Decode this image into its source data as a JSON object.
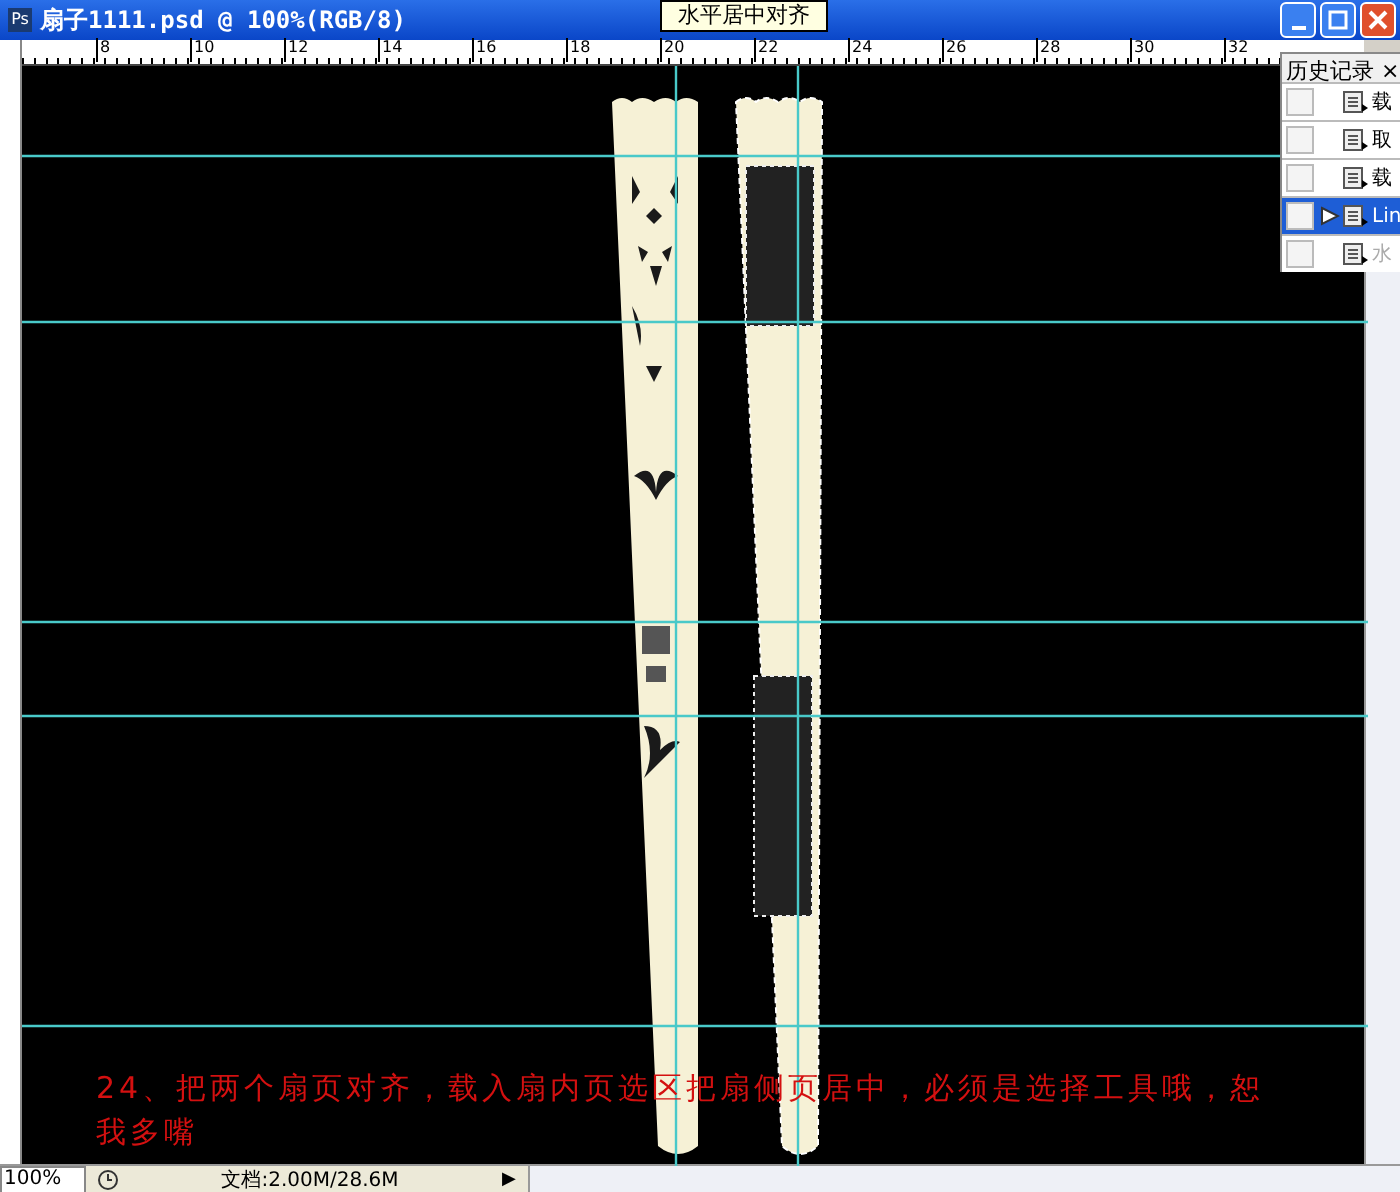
{
  "window": {
    "title": "扇子1111.psd @ 100%(RGB/8)",
    "icon": "Ps"
  },
  "tooltip": "水平居中对齐",
  "ruler": {
    "labels": [
      "8",
      "10",
      "12",
      "14",
      "16",
      "18",
      "20",
      "22",
      "24",
      "26",
      "28",
      "30",
      "32"
    ]
  },
  "caption": "24、把两个扇页对齐，载入扇内页选区把扇侧页居中，必须是选择工具哦，恕我多嘴",
  "history_panel": {
    "title": "历史记录",
    "close": "×",
    "items": [
      {
        "label": "载",
        "selected": false,
        "disabled": false
      },
      {
        "label": "取",
        "selected": false,
        "disabled": false
      },
      {
        "label": "载",
        "selected": false,
        "disabled": false
      },
      {
        "label": "Lin",
        "selected": true,
        "disabled": false
      },
      {
        "label": "水",
        "selected": false,
        "disabled": true
      }
    ]
  },
  "status_bar": {
    "zoom": "100%",
    "document": "文档:2.00M/28.6M",
    "arrow": "▶"
  }
}
